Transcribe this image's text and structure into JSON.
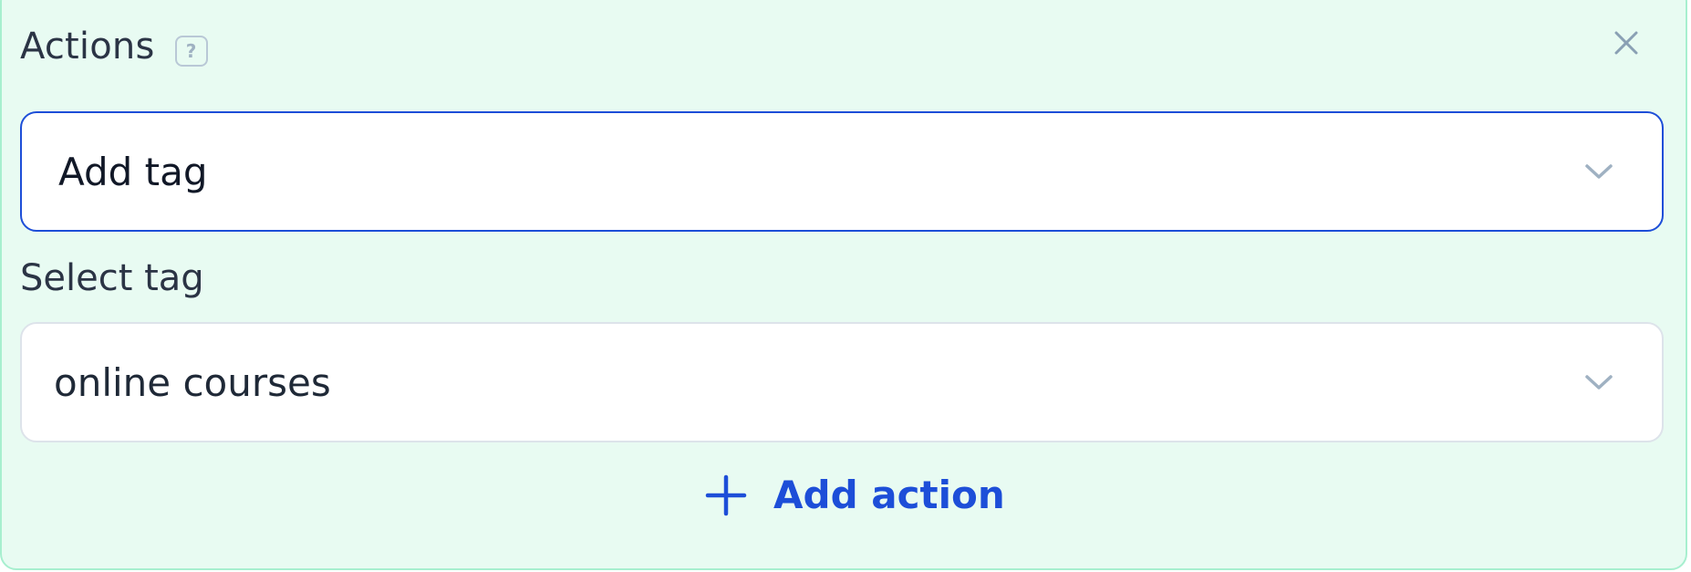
{
  "actions_panel": {
    "title": "Actions",
    "help_icon_glyph": "?",
    "close_icon": "close-icon",
    "action_select": {
      "value": "Add tag",
      "icon": "chevron-down-icon"
    },
    "tag_field": {
      "label": "Select tag",
      "value": "online courses",
      "icon": "chevron-down-icon"
    },
    "add_action": {
      "label": "Add action",
      "icon": "plus-icon"
    }
  },
  "colors": {
    "panel_background": "#e8fbf2",
    "accent": "#1d4ed8",
    "text": "#2b3445",
    "muted_icon": "#9fb1c2"
  }
}
